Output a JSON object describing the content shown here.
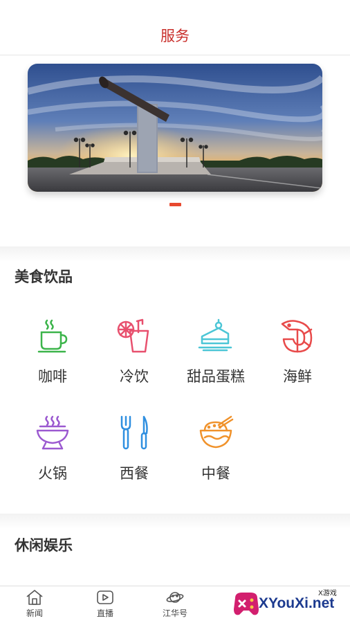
{
  "header": {
    "title": "服务"
  },
  "banner": {
    "slide_count": 1,
    "active_index": 0
  },
  "sections": [
    {
      "title": "美食饮品",
      "items": [
        {
          "label": "咖啡",
          "icon": "coffee-cup-icon",
          "color": "#3bb44a"
        },
        {
          "label": "冷饮",
          "icon": "cold-drink-icon",
          "color": "#e8506e"
        },
        {
          "label": "甜品蛋糕",
          "icon": "cake-icon",
          "color": "#4cc6d6"
        },
        {
          "label": "海鲜",
          "icon": "seafood-shrimp-icon",
          "color": "#e84a4a"
        },
        {
          "label": "火锅",
          "icon": "hotpot-icon",
          "color": "#9b59d0"
        },
        {
          "label": "西餐",
          "icon": "fork-knife-icon",
          "color": "#2f8fe0"
        },
        {
          "label": "中餐",
          "icon": "rice-bowl-icon",
          "color": "#f0922b"
        }
      ]
    },
    {
      "title": "休闲娱乐"
    }
  ],
  "tabbar": {
    "items": [
      {
        "label": "新闻",
        "icon": "home-icon"
      },
      {
        "label": "直播",
        "icon": "play-icon"
      },
      {
        "label": "江华号",
        "icon": "planet-icon"
      }
    ]
  },
  "watermark": {
    "text": "XYouXi.net",
    "small": "X游戏"
  }
}
